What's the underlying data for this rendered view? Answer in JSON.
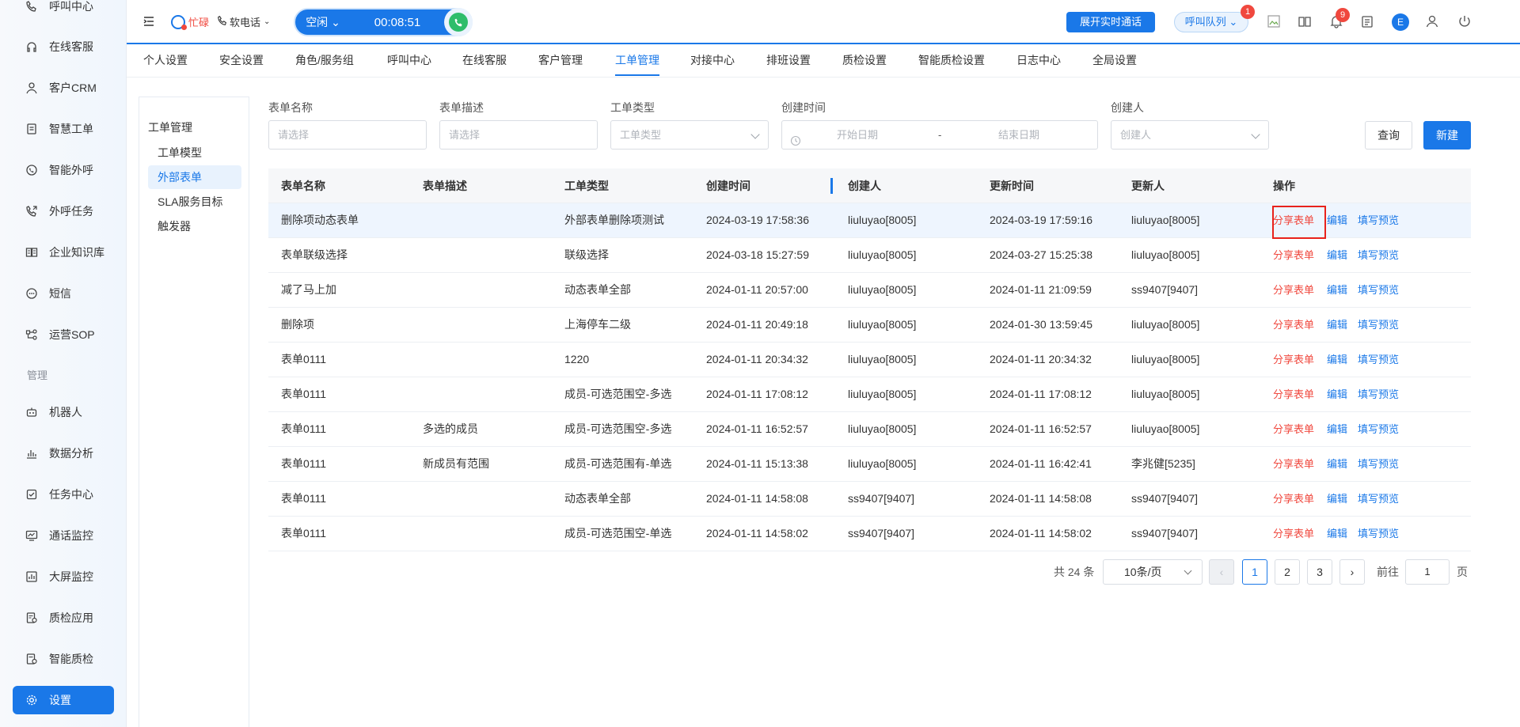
{
  "sidebar": {
    "items": [
      {
        "label": "呼叫中心",
        "icon": "phone-icon"
      },
      {
        "label": "在线客服",
        "icon": "headset-icon"
      },
      {
        "label": "客户CRM",
        "icon": "user-icon"
      },
      {
        "label": "智慧工单",
        "icon": "document-icon"
      },
      {
        "label": "智能外呼",
        "icon": "whatsapp-phone-icon"
      },
      {
        "label": "外呼任务",
        "icon": "outbound-call-icon"
      },
      {
        "label": "企业知识库",
        "icon": "book-icon"
      },
      {
        "label": "短信",
        "icon": "sms-icon"
      },
      {
        "label": "运营SOP",
        "icon": "flow-icon"
      }
    ],
    "section_label": "管理",
    "admin_items": [
      {
        "label": "机器人",
        "icon": "robot-icon"
      },
      {
        "label": "数据分析",
        "icon": "bar-chart-icon"
      },
      {
        "label": "任务中心",
        "icon": "task-check-icon"
      },
      {
        "label": "通话监控",
        "icon": "monitor-line-icon"
      },
      {
        "label": "大屏监控",
        "icon": "screen-chart-icon"
      },
      {
        "label": "质检应用",
        "icon": "quality-doc-icon"
      },
      {
        "label": "智能质检",
        "icon": "smart-quality-icon"
      },
      {
        "label": "设置",
        "icon": "gear-icon"
      }
    ]
  },
  "header": {
    "status_label": "忙碌",
    "softphone_label": "软电话",
    "call_state": "空闲",
    "call_timer": "00:08:51",
    "expand_button": "展开实时通话",
    "queue_button": "呼叫队列",
    "queue_badge": "1",
    "notification_badge": "9",
    "avatar_letter": "E"
  },
  "tabs": [
    "个人设置",
    "安全设置",
    "角色/服务组",
    "呼叫中心",
    "在线客服",
    "客户管理",
    "工单管理",
    "对接中心",
    "排班设置",
    "质检设置",
    "智能质检设置",
    "日志中心",
    "全局设置"
  ],
  "active_tab": "工单管理",
  "subnav": {
    "title": "工单管理",
    "items": [
      "工单模型",
      "外部表单",
      "SLA服务目标",
      "触发器"
    ],
    "active": "外部表单"
  },
  "filters": {
    "form_name": {
      "label": "表单名称",
      "placeholder": "请选择"
    },
    "form_desc": {
      "label": "表单描述",
      "placeholder": "请选择"
    },
    "ticket_type": {
      "label": "工单类型",
      "placeholder": "工单类型"
    },
    "created_time": {
      "label": "创建时间",
      "start": "开始日期",
      "sep": "-",
      "end": "结束日期"
    },
    "creator": {
      "label": "创建人",
      "placeholder": "创建人"
    },
    "query_button": "查询",
    "new_button": "新建"
  },
  "table": {
    "columns": [
      "表单名称",
      "表单描述",
      "工单类型",
      "创建时间",
      "创建人",
      "更新时间",
      "更新人",
      "操作"
    ],
    "actions": {
      "share": "分享表单",
      "edit": "编辑",
      "preview": "填写预览"
    },
    "rows": [
      [
        "删除项动态表单",
        "",
        "外部表单删除项测试",
        "2024-03-19 17:58:36",
        "liuluyao[8005]",
        "2024-03-19 17:59:16",
        "liuluyao[8005]"
      ],
      [
        "表单联级选择",
        "",
        "联级选择",
        "2024-03-18 15:27:59",
        "liuluyao[8005]",
        "2024-03-27 15:25:38",
        "liuluyao[8005]"
      ],
      [
        "减了马上加",
        "",
        "动态表单全部",
        "2024-01-11 20:57:00",
        "liuluyao[8005]",
        "2024-01-11 21:09:59",
        "ss9407[9407]"
      ],
      [
        "删除项",
        "",
        "上海停车二级",
        "2024-01-11 20:49:18",
        "liuluyao[8005]",
        "2024-01-30 13:59:45",
        "liuluyao[8005]"
      ],
      [
        "表单0111",
        "",
        "1220",
        "2024-01-11 20:34:32",
        "liuluyao[8005]",
        "2024-01-11 20:34:32",
        "liuluyao[8005]"
      ],
      [
        "表单0111",
        "",
        "成员-可选范围空-多选",
        "2024-01-11 17:08:12",
        "liuluyao[8005]",
        "2024-01-11 17:08:12",
        "liuluyao[8005]"
      ],
      [
        "表单0111",
        "多选的成员",
        "成员-可选范围空-多选",
        "2024-01-11 16:52:57",
        "liuluyao[8005]",
        "2024-01-11 16:52:57",
        "liuluyao[8005]"
      ],
      [
        "表单0111",
        "新成员有范围",
        "成员-可选范围有-单选",
        "2024-01-11 15:13:38",
        "liuluyao[8005]",
        "2024-01-11 16:42:41",
        "李兆健[5235]"
      ],
      [
        "表单0111",
        "",
        "动态表单全部",
        "2024-01-11 14:58:08",
        "ss9407[9407]",
        "2024-01-11 14:58:08",
        "ss9407[9407]"
      ],
      [
        "表单0111",
        "",
        "成员-可选范围空-单选",
        "2024-01-11 14:58:02",
        "ss9407[9407]",
        "2024-01-11 14:58:02",
        "ss9407[9407]"
      ]
    ]
  },
  "pagination": {
    "total": "共 24 条",
    "page_size": "10条/页",
    "pages": [
      "1",
      "2",
      "3"
    ],
    "current": "1",
    "goto_label": "前往",
    "goto_value": "1",
    "page_suffix": "页"
  },
  "colors": {
    "accent": "#1a78e8",
    "danger": "#f0483e",
    "success": "#2ebd6b"
  }
}
